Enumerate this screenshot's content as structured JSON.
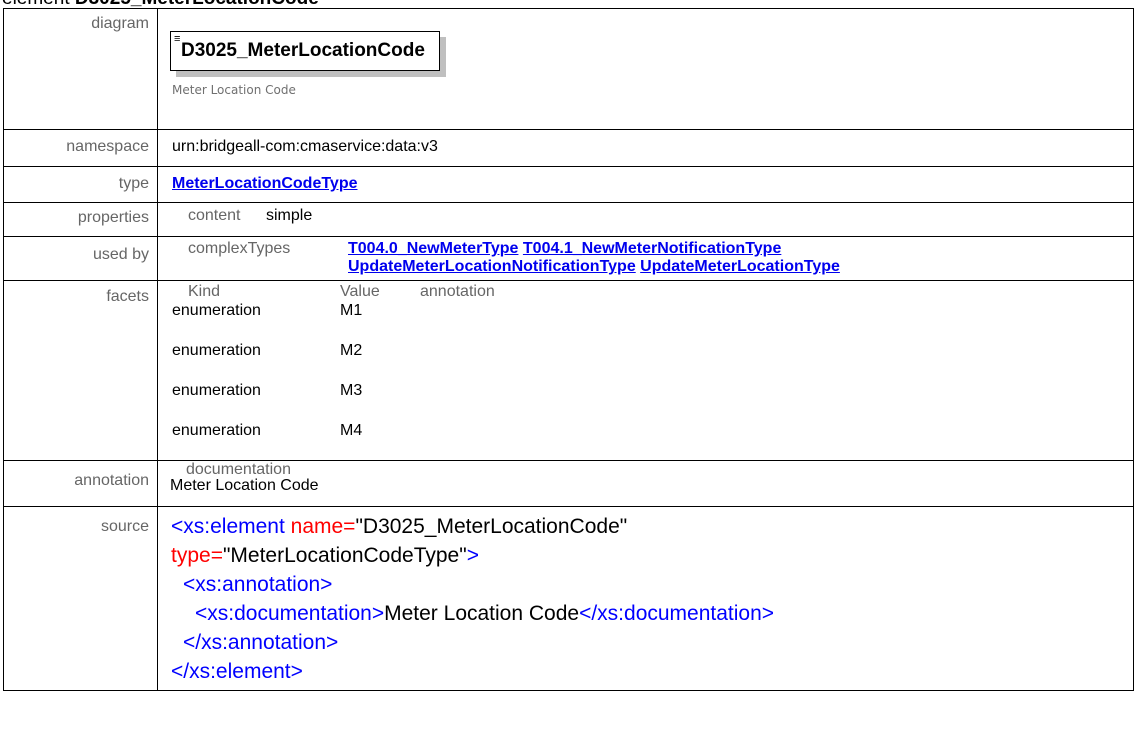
{
  "page_title": {
    "prefix": "element",
    "name": "D3025_MeterLocationCode"
  },
  "labels": {
    "diagram": "diagram",
    "namespace": "namespace",
    "type": "type",
    "properties": "properties",
    "used_by": "used by",
    "facets": "facets",
    "annotation": "annotation",
    "source": "source"
  },
  "diagram": {
    "element_name": "D3025_MeterLocationCode",
    "annotation": "Meter Location Code"
  },
  "namespace": "urn:bridgeall-com:cmaservice:data:v3",
  "type_link": "MeterLocationCodeType",
  "properties": {
    "key": "content",
    "value": "simple"
  },
  "used_by": {
    "category": "complexTypes",
    "links": [
      "T004.0_NewMeterType",
      "T004.1_NewMeterNotificationType",
      "UpdateMeterLocationNotificationType",
      "UpdateMeterLocationType"
    ]
  },
  "facets": {
    "headers": [
      "Kind",
      "Value",
      "annotation"
    ],
    "rows": [
      {
        "kind": "enumeration",
        "value": "M1"
      },
      {
        "kind": "enumeration",
        "value": "M2"
      },
      {
        "kind": "enumeration",
        "value": "M3"
      },
      {
        "kind": "enumeration",
        "value": "M4"
      }
    ]
  },
  "annotation": {
    "heading": "documentation",
    "text": "Meter Location Code"
  },
  "source": {
    "open_tag": "<xs:element",
    "name_attr": "name=",
    "name_val": "\"D3025_MeterLocationCode\"",
    "type_attr": "type=",
    "type_val": "\"MeterLocationCodeType\"",
    "gt": ">",
    "annotation_open": "<xs:annotation>",
    "doc_open": "<xs:documentation>",
    "doc_text": "Meter Location Code",
    "doc_close": "</xs:documentation>",
    "annotation_close": "</xs:annotation>",
    "element_close": "</xs:element>"
  }
}
